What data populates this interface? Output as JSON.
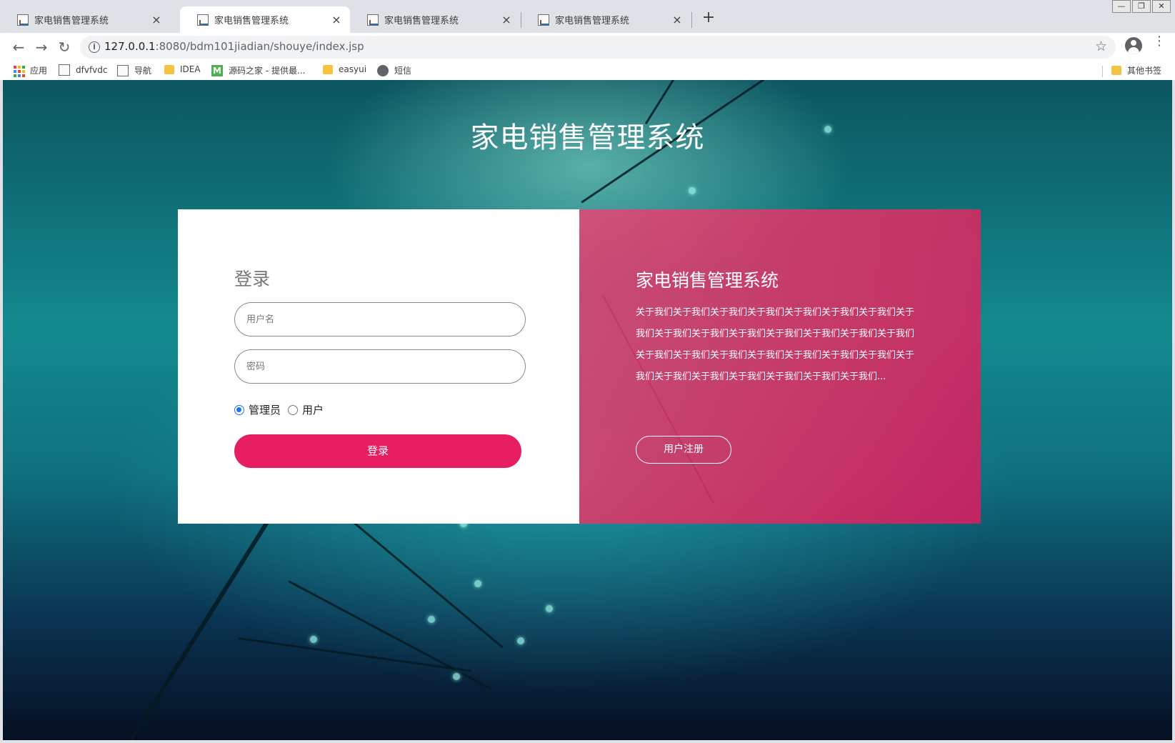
{
  "browser": {
    "tabs": [
      {
        "title": "家电销售管理系统",
        "close": "×"
      },
      {
        "title": "家电销售管理系统",
        "close": "×"
      },
      {
        "title": "家电销售管理系统",
        "close": "×"
      },
      {
        "title": "家电销售管理系统",
        "close": "×"
      }
    ],
    "new_tab": "+",
    "window_controls": [
      "—",
      "❐",
      "✕"
    ],
    "url_host": "127.0.0.1",
    "url_rest": ":8080/bdm101jiadian/shouye/index.jsp",
    "bookmarks": [
      {
        "label": "应用",
        "icon": "apps-icon"
      },
      {
        "label": "dfvfvdc",
        "icon": "page-icon"
      },
      {
        "label": "导航",
        "icon": "page-icon"
      },
      {
        "label": "IDEA",
        "icon": "folder-icon"
      },
      {
        "label": "源码之家 - 提供最...",
        "icon": "m-icon"
      },
      {
        "label": "easyui",
        "icon": "folder-icon"
      },
      {
        "label": "短信",
        "icon": "globe-icon"
      }
    ],
    "other_bookmarks": "其他书签"
  },
  "page": {
    "site_title": "家电销售管理系统",
    "login": {
      "heading": "登录",
      "username_placeholder": "用户名",
      "password_placeholder": "密码",
      "roles": [
        {
          "label": "管理员",
          "checked": true
        },
        {
          "label": "用户",
          "checked": false
        }
      ],
      "submit_label": "登录"
    },
    "info": {
      "title": "家电销售管理系统",
      "description": "关于我们关于我们关于我们关于我们关于我们关于我们关于我们关于我们关于我们关于我们关于我们关于我们关于我们关于我们关于我们关于我们关于我们关于我们关于我们关于我们关于我们关于我们关于我们关于我们关于我们关于我们关于我们关于我们关于我们...",
      "register_label": "用户注册"
    }
  },
  "colors": {
    "accent": "#e71e62",
    "info_panel": "#e22c62",
    "background": "#0f6f7e"
  }
}
